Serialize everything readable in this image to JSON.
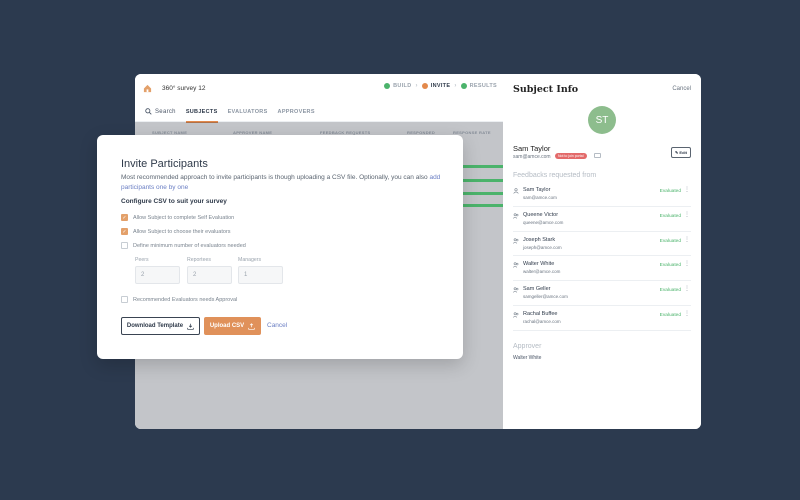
{
  "colors": {
    "background": "#2c3a4f",
    "accent": "#e3894b",
    "success": "#4bb36b",
    "link": "#6b7fc4"
  },
  "header": {
    "survey_title": "360° survey 12",
    "steps": [
      {
        "label": "BUILD",
        "state": "done"
      },
      {
        "label": "INVITE",
        "state": "active"
      },
      {
        "label": "RESULTS",
        "state": "done"
      }
    ]
  },
  "tabs": {
    "search_label": "Search",
    "items": [
      {
        "label": "SUBJECTS",
        "active": true
      },
      {
        "label": "EVALUATORS",
        "active": false
      },
      {
        "label": "APPROVERS",
        "active": false
      }
    ]
  },
  "table": {
    "columns": [
      "SUBJECT NAME",
      "APPROVER NAME",
      "FEEDBACK REQUESTS",
      "RESPONDED",
      "RESPONSE RATE"
    ]
  },
  "panel": {
    "title": "Subject Info",
    "cancel_label": "Cancel",
    "avatar_initials": "ST",
    "subject_name": "Sam Taylor",
    "subject_email": "sam@amce.com",
    "subject_badge": "Not to join portal",
    "edit_label": "✎ Edit",
    "feedbacks_heading": "Feedbacks requested from",
    "feedbacks": [
      {
        "name": "Sam Taylor",
        "email": "sam@amce.com",
        "status": "Evaluated",
        "icon": "person-icon"
      },
      {
        "name": "Queene Victor",
        "email": "queene@amce.com",
        "status": "Evaluated",
        "icon": "people-icon"
      },
      {
        "name": "Joseph Stark",
        "email": "joseph@amce.com",
        "status": "Evaluated",
        "icon": "people-icon"
      },
      {
        "name": "Walter White",
        "email": "walter@amce.com",
        "status": "Evaluated",
        "icon": "people-icon"
      },
      {
        "name": "Sam Geller",
        "email": "samgeller@amce.com",
        "status": "Evaluated",
        "icon": "people-icon"
      },
      {
        "name": "Rachal Buffee",
        "email": "rachal@amce.com",
        "status": "Evaluated",
        "icon": "people-icon"
      }
    ],
    "approver_heading": "Approver",
    "approver_name": "Walter White"
  },
  "modal": {
    "title": "Invite Participants",
    "description": "Most recommended approach to invite participants is though uploading a CSV file. Optionally, you can also",
    "description_link": "add participants one by one",
    "config_heading": "Configure CSV to suit your survey",
    "options": [
      {
        "label": "Allow Subject to complete Self Evaluation",
        "checked": true
      },
      {
        "label": "Allow Subject to choose their evaluators",
        "checked": true
      },
      {
        "label": "Define minimum number of evaluators needed",
        "checked": false
      }
    ],
    "fields": [
      {
        "label": "Peers",
        "value": "2"
      },
      {
        "label": "Reportees",
        "value": "2"
      },
      {
        "label": "Managers",
        "value": "1"
      }
    ],
    "approval_option": {
      "label": "Recommended Evaluators needs Approval",
      "checked": false
    },
    "download_label": "Download Template",
    "upload_label": "Upload CSV",
    "cancel_label": "Cancel"
  }
}
